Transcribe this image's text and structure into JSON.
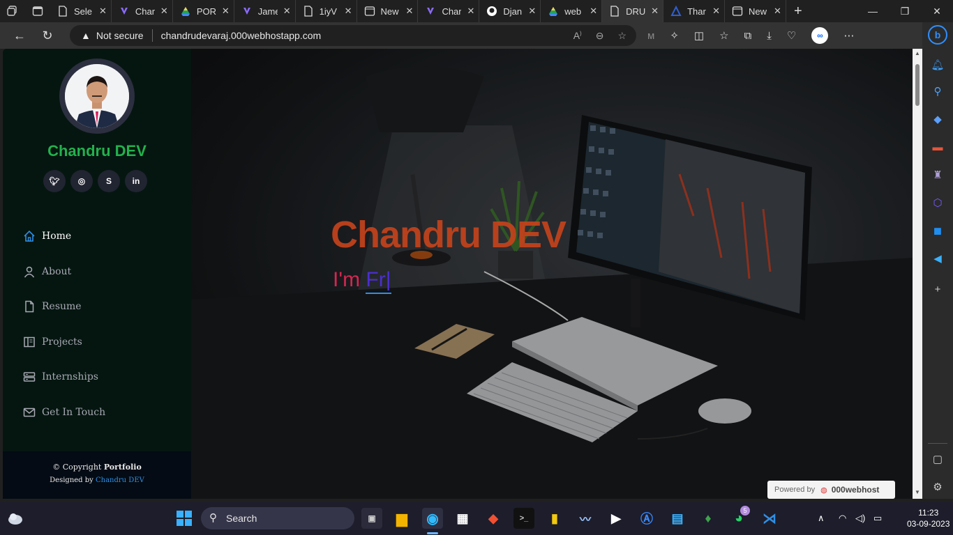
{
  "browser": {
    "tabs": [
      {
        "title": "Sele",
        "icon": "page-icon"
      },
      {
        "title": "Char",
        "icon": "copilot-icon"
      },
      {
        "title": "POR",
        "icon": "drive-icon"
      },
      {
        "title": "Jame",
        "icon": "copilot-icon"
      },
      {
        "title": "1iyV",
        "icon": "page-icon"
      },
      {
        "title": "New",
        "icon": "newtab-icon"
      },
      {
        "title": "Char",
        "icon": "copilot-icon"
      },
      {
        "title": "Djan",
        "icon": "github-icon"
      },
      {
        "title": "web",
        "icon": "drive-icon"
      },
      {
        "title": "DRU",
        "icon": "page-icon",
        "active": true
      },
      {
        "title": "Thar",
        "icon": "logo-icon"
      },
      {
        "title": "New",
        "icon": "newtab-icon"
      }
    ],
    "security_label": "Not secure",
    "url": "chandrudevaraj.000webhostapp.com",
    "accent": "#2f8fff"
  },
  "portfolio": {
    "name": "Chandru DEV",
    "socials": [
      "twitter-icon",
      "instagram-icon",
      "skype-icon",
      "linkedin-icon"
    ],
    "nav": [
      {
        "label": "Home",
        "icon": "home-icon",
        "active": true
      },
      {
        "label": "About",
        "icon": "user-icon"
      },
      {
        "label": "Resume",
        "icon": "file-icon"
      },
      {
        "label": "Projects",
        "icon": "book-icon"
      },
      {
        "label": "Internships",
        "icon": "server-icon"
      },
      {
        "label": "Get In Touch",
        "icon": "envelope-icon"
      }
    ],
    "footer": {
      "copyright_prefix": "© Copyright",
      "copyright_bold": "Portfolio",
      "designed_prefix": "Designed by",
      "designed_link": "Chandru DEV"
    },
    "hero": {
      "title": "Chandru DEV",
      "typed_prefix": "I'm",
      "typed_text": "Fr|"
    },
    "badge": {
      "prefix": "Powered by",
      "brand": "000webhost"
    },
    "colors": {
      "name_green": "#23b14d",
      "hero_title": "#c4431c",
      "typed_pink": "#d62650",
      "typed_purple": "#4b2fd0"
    }
  },
  "taskbar": {
    "search_label": "Search",
    "notification_count": "5",
    "time": "11:23",
    "date": "03-09-2023"
  }
}
